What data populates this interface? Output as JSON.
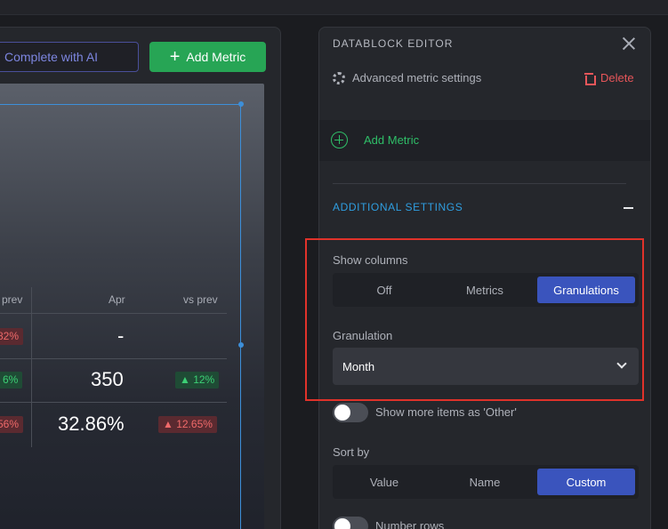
{
  "toolbar": {
    "complete_ai_label": "Complete with AI",
    "add_metric_label": "Add Metric"
  },
  "table": {
    "headers": [
      "prev",
      "Apr",
      "vs prev"
    ],
    "rows": [
      {
        "prev_badge": "82%",
        "prev_badge_status": "negative",
        "apr": "-",
        "vs_prev": ""
      },
      {
        "prev_badge": "6%",
        "prev_badge_status": "positive",
        "apr": "350",
        "vs_prev": "▲ 12%",
        "vs_prev_status": "positive"
      },
      {
        "prev_badge": "56%",
        "prev_badge_status": "negative",
        "apr": "32.86%",
        "vs_prev": "▲ 12.65%",
        "vs_prev_status": "negative"
      }
    ]
  },
  "editor": {
    "title": "DATABLOCK EDITOR",
    "advanced_label": "Advanced metric settings",
    "delete_label": "Delete",
    "add_metric_label": "Add Metric",
    "additional_settings_label": "ADDITIONAL SETTINGS",
    "show_columns": {
      "label": "Show columns",
      "options": [
        "Off",
        "Metrics",
        "Granulations"
      ],
      "selected": "Granulations"
    },
    "granulation": {
      "label": "Granulation",
      "value": "Month"
    },
    "show_more_toggle": {
      "label": "Show more items as 'Other'",
      "on": false
    },
    "sort_by": {
      "label": "Sort by",
      "options": [
        "Value",
        "Name",
        "Custom"
      ],
      "selected": "Custom"
    },
    "number_rows_toggle": {
      "label": "Number rows",
      "on": false
    }
  },
  "icons": {
    "close": "close-icon",
    "gear": "gear-icon",
    "trash": "trash-icon",
    "plus_circle": "plus-circle-icon",
    "collapse": "minus-icon",
    "chevron": "chevron-down-icon"
  },
  "colors": {
    "accent_blue": "#3a54bd",
    "success_green": "#27a555",
    "danger_red": "#e8565a",
    "highlight_box": "#e0322a"
  }
}
